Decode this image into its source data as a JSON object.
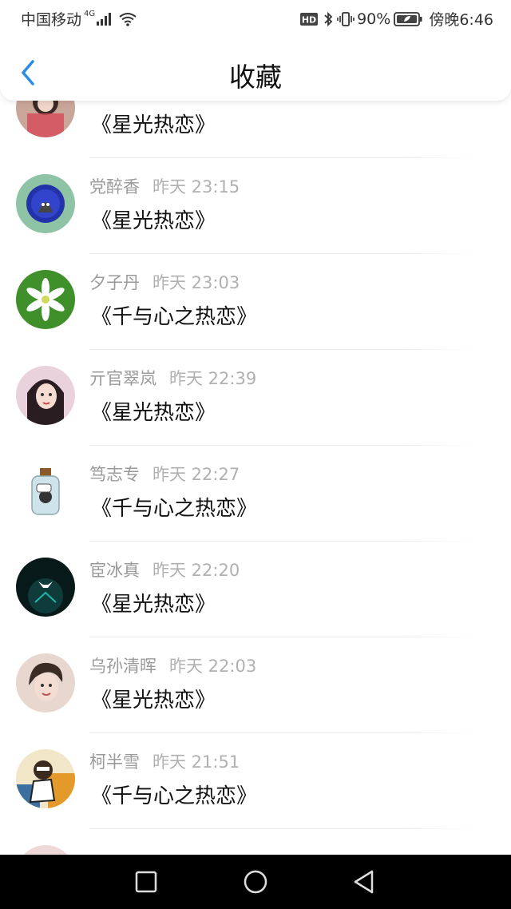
{
  "status_bar": {
    "carrier": "中国移动",
    "network": "4G",
    "battery": "90%",
    "time": "傍晚6:46"
  },
  "header": {
    "title": "收藏",
    "back_icon": "chevron-left-icon"
  },
  "favorites": [
    {
      "name": "",
      "time": "",
      "title": "《星光热恋》",
      "avatar_color": "#c9a69a"
    },
    {
      "name": "党醉香",
      "time": "昨天 23:15",
      "title": "《星光热恋》",
      "avatar_color": "#8fc3a6"
    },
    {
      "name": "夕子丹",
      "time": "昨天 23:03",
      "title": "《千与心之热恋》",
      "avatar_color": "#3f8f2a"
    },
    {
      "name": "亓官翠岚",
      "time": "昨天 22:39",
      "title": "《星光热恋》",
      "avatar_color": "#e9d2dc"
    },
    {
      "name": "笃志专",
      "time": "昨天 22:27",
      "title": "《千与心之热恋》",
      "avatar_color": "#cfe3ea"
    },
    {
      "name": "宦冰真",
      "time": "昨天 22:20",
      "title": "《星光热恋》",
      "avatar_color": "#0f3b3a"
    },
    {
      "name": "乌孙清晖",
      "time": "昨天 22:03",
      "title": "《星光热恋》",
      "avatar_color": "#e7d7cf"
    },
    {
      "name": "柯半雪",
      "time": "昨天 21:51",
      "title": "《千与心之热恋》",
      "avatar_color": "#3b2b1f"
    }
  ],
  "nav_bar": {
    "recent_icon": "square-icon",
    "home_icon": "circle-icon",
    "back_icon": "triangle-back-icon"
  }
}
